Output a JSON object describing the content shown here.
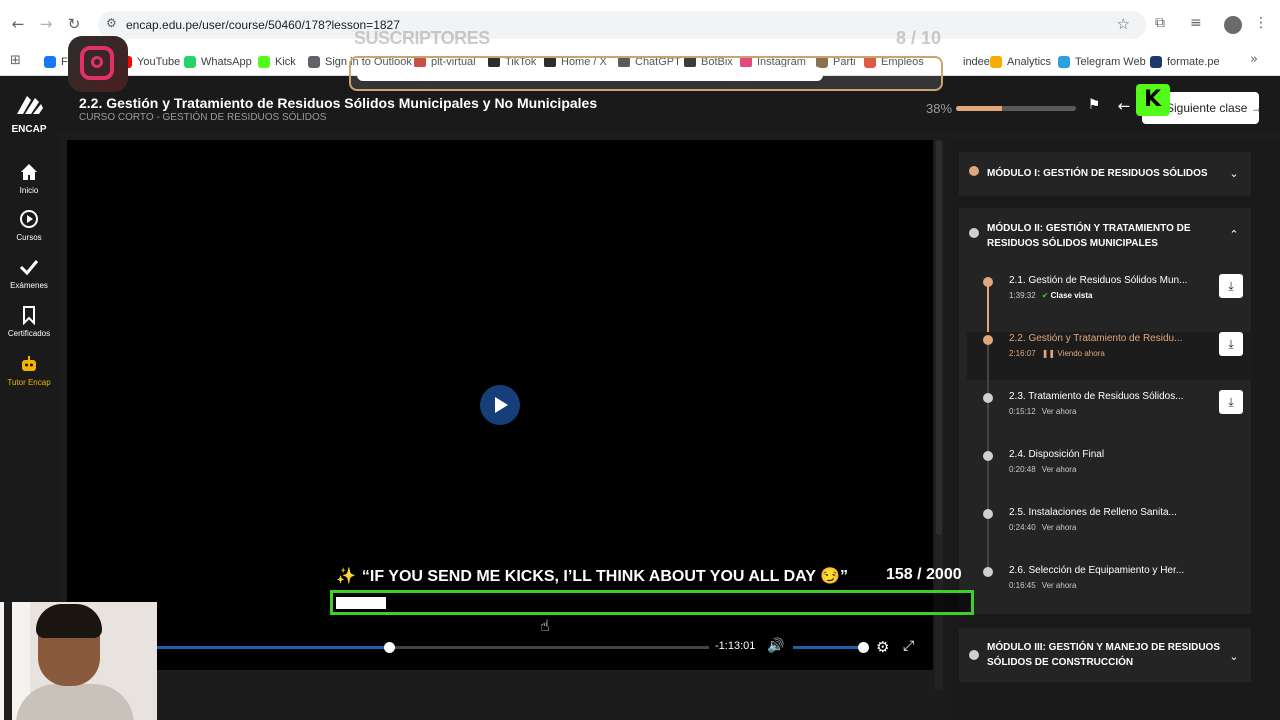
{
  "browser": {
    "url": "encap.edu.pe/user/course/50460/178?lesson=1827",
    "bookmarks": [
      {
        "label": "F",
        "color": "#1877f2"
      },
      {
        "label": "YouTube",
        "color": "#ff0000"
      },
      {
        "label": "WhatsApp",
        "color": "#25d366"
      },
      {
        "label": "Kick",
        "color": "#53fc18"
      },
      {
        "label": "Sign in to Outlook",
        "color": "#5f6368"
      },
      {
        "label": "plt-virtual",
        "color": "#c0392b"
      },
      {
        "label": "TikTok",
        "color": "#111111"
      },
      {
        "label": "Home / X",
        "color": "#111111"
      },
      {
        "label": "ChatGPT",
        "color": "#444444"
      },
      {
        "label": "BotBix",
        "color": "#222222"
      },
      {
        "label": "Instagram",
        "color": "#e1306c"
      },
      {
        "label": "Parti",
        "color": "#7b5e3b"
      },
      {
        "label": "Empleos",
        "color": "#d9442b"
      },
      {
        "label": "indeed",
        "color": "#ffffff"
      },
      {
        "label": "Analytics",
        "color": "#f9ab00"
      },
      {
        "label": "Telegram Web",
        "color": "#2aa1df"
      },
      {
        "label": "formate.pe",
        "color": "#1b3a6b"
      }
    ]
  },
  "header": {
    "title": "2.2. Gestión y Tratamiento de Residuos Sólidos Municipales y No Municipales",
    "subtitle": "CURSO CORTO - GESTIÓN DE RESIDUOS SÓLIDOS",
    "progress_text": "38%",
    "progress": 0.38,
    "next_label": "Siguiente clase"
  },
  "nav": {
    "brand": "ENCAP",
    "items": [
      {
        "label": "Inicio",
        "icon": "home-icon"
      },
      {
        "label": "Cursos",
        "icon": "play-circle-icon"
      },
      {
        "label": "Exámenes",
        "icon": "check-icon"
      },
      {
        "label": "Certificados",
        "icon": "bookmark-icon"
      },
      {
        "label": "Tutor Encap",
        "icon": "robot-icon"
      }
    ]
  },
  "player": {
    "time_remaining": "-1:13:01",
    "seek_position": 0.42,
    "volume": 1.0
  },
  "modules": [
    {
      "title": "MÓDULO I: GESTIÓN DE RESIDUOS SÓLIDOS",
      "done": true,
      "expanded": false
    },
    {
      "title": "MÓDULO II: GESTIÓN Y TRATAMIENTO DE RESIDUOS SÓLIDOS MUNICIPALES",
      "done": false,
      "expanded": true
    },
    {
      "title": "MÓDULO III: GESTIÓN Y MANEJO DE RESIDUOS SÓLIDOS DE CONSTRUCCIÓN",
      "done": false,
      "expanded": false
    }
  ],
  "lessons": [
    {
      "title": "2.1. Gestión de Residuos Sólidos Mun...",
      "duration": "1:39:32",
      "status": "Clase vista",
      "state": "done",
      "download": true
    },
    {
      "title": "2.2. Gestión y Tratamiento de Residu...",
      "duration": "2:16:07",
      "status": "Viendo ahora",
      "state": "active",
      "download": true
    },
    {
      "title": "2.3. Tratamiento de Residuos Sólidos...",
      "duration": "0:15:12",
      "status": "Ver ahora",
      "state": "todo",
      "download": true
    },
    {
      "title": "2.4. Disposición Final",
      "duration": "0:20:48",
      "status": "Ver ahora",
      "state": "todo",
      "download": false
    },
    {
      "title": "2.5. Instalaciones de Relleno Sanita...",
      "duration": "0:24:40",
      "status": "Ver ahora",
      "state": "todo",
      "download": false
    },
    {
      "title": "2.6. Selección de Equipamiento y Her...",
      "duration": "0:16:45",
      "status": "Ver ahora",
      "state": "todo",
      "download": false
    }
  ],
  "overlay": {
    "subs_label": "SUSCRIPTORES",
    "subs_count": "8 / 10",
    "subs_progress": 0.8,
    "kick_goal": "“IF YOU SEND ME KICKS, I’LL THINK ABOUT YOU ALL DAY 😏”",
    "kick_count": "158 / 2000",
    "kick_progress": 0.079,
    "kick_logo": "K"
  }
}
